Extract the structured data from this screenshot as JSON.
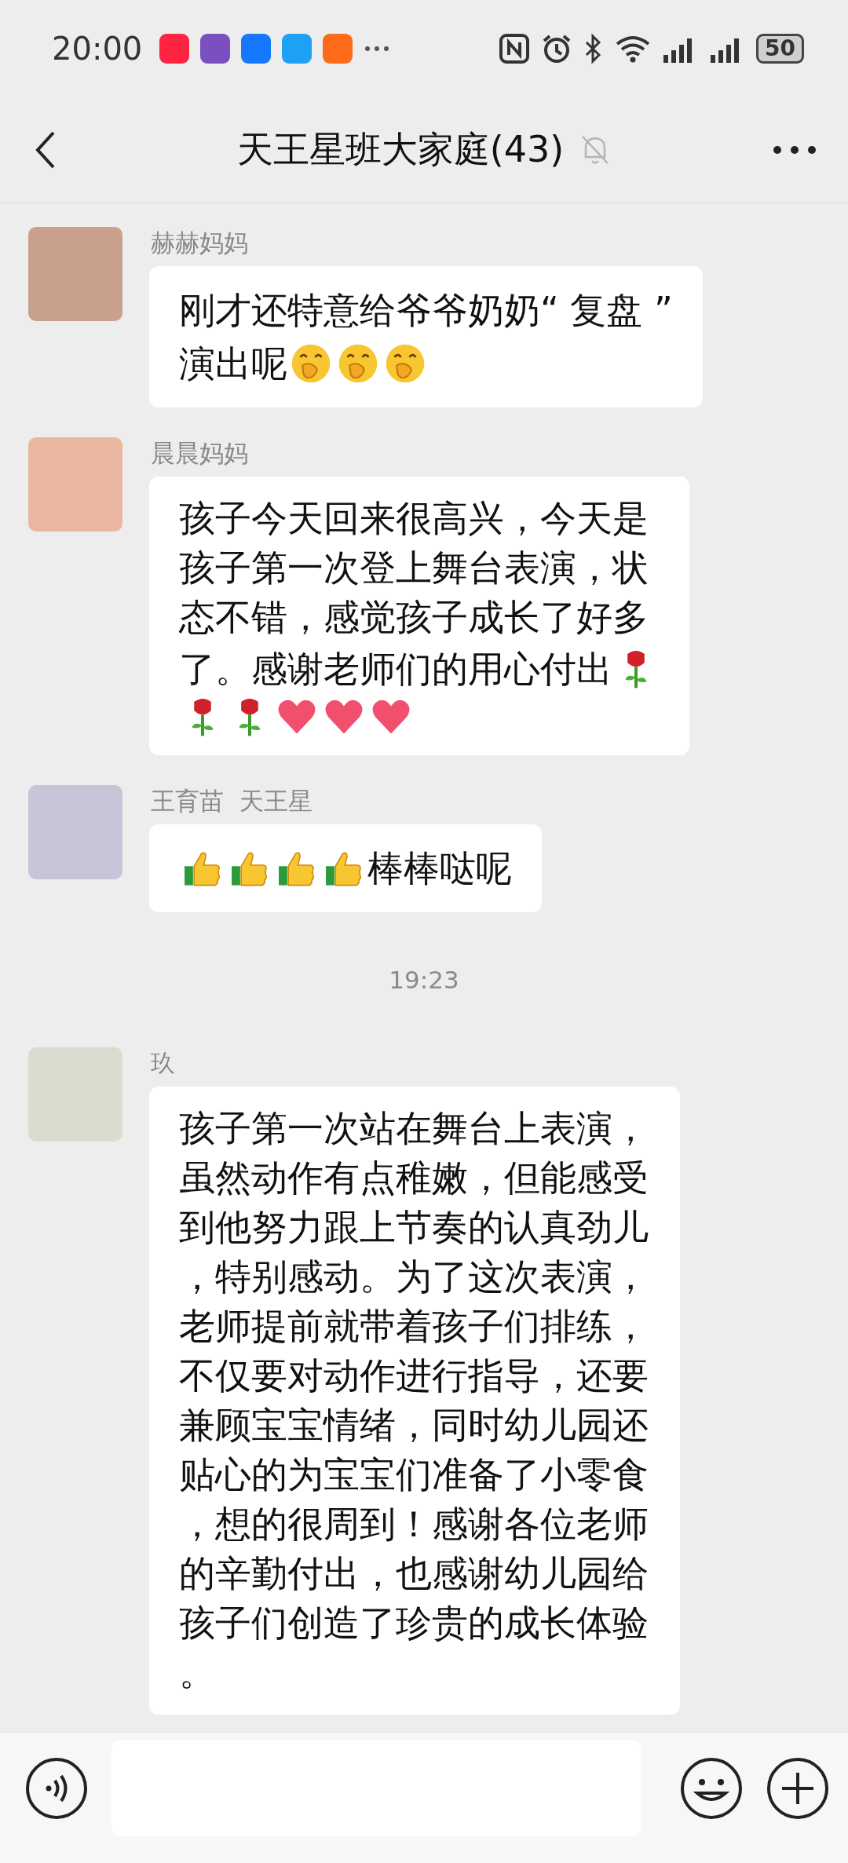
{
  "status_bar": {
    "time": "20:00",
    "battery": "50"
  },
  "header": {
    "title": "天王星班大家庭(43)",
    "muted": true
  },
  "items": [
    {
      "kind": "message",
      "sender": "赫赫妈妈",
      "lines": [
        [
          {
            "kind": "text",
            "text": "刚才还特意给爷爷奶奶“ 复盘 ”"
          }
        ],
        [
          {
            "kind": "text",
            "text": "演出呢"
          },
          {
            "kind": "giggle"
          },
          {
            "kind": "giggle"
          },
          {
            "kind": "giggle"
          }
        ]
      ]
    },
    {
      "kind": "message",
      "sender": "晨晨妈妈",
      "lines": [
        [
          {
            "kind": "text",
            "text": "孩子今天回来很高兴，今天是孩子第一次登上舞台表演，状态不错，感觉孩子成长了好多"
          }
        ],
        [
          {
            "kind": "text",
            "text": "了。感谢老师们的用心付出"
          },
          {
            "kind": "rose"
          }
        ],
        [
          {
            "kind": "rose"
          },
          {
            "kind": "rose"
          },
          {
            "kind": "heart"
          },
          {
            "kind": "heart"
          },
          {
            "kind": "heart"
          }
        ]
      ]
    },
    {
      "kind": "message",
      "sender": "王育苗  天王星",
      "lines": [
        [
          {
            "kind": "thumb"
          },
          {
            "kind": "thumb"
          },
          {
            "kind": "thumb"
          },
          {
            "kind": "thumb"
          },
          {
            "kind": "text",
            "text": "棒棒哒呢"
          }
        ]
      ]
    },
    {
      "kind": "time",
      "text": "19:23"
    },
    {
      "kind": "message",
      "sender": "玖",
      "lines": [
        [
          {
            "kind": "text",
            "text": "孩子第一次站在舞台上表演，虽然动作有点稚嫩，但能感受到他努力跟上节奏的认真劲儿，特别感动。为了这次表演，老师提前就带着孩子们排练，不仅要对动作进行指导，还要兼顾宝宝情绪，同时幼儿园还贴心的为宝宝们准备了小零食，想的很周到！感谢各位老师的辛勤付出，也感谢幼儿园给孩子们创造了珍贵的成长体验。"
          }
        ]
      ]
    }
  ]
}
